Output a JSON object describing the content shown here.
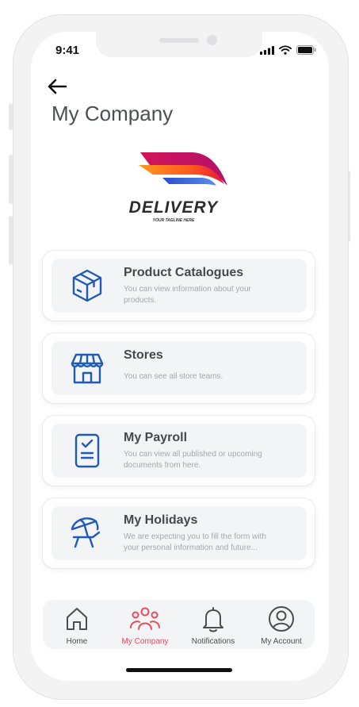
{
  "status": {
    "time": "9:41"
  },
  "page": {
    "title": "My Company"
  },
  "logo": {
    "name": "DELIVERY",
    "tagline": "YOUR TAGLINE HERE"
  },
  "menu": [
    {
      "icon": "box-icon",
      "title": "Product Catalogues",
      "description": "You can view information about your products."
    },
    {
      "icon": "store-icon",
      "title": "Stores",
      "description": "You can see all store teams."
    },
    {
      "icon": "clipboard-check-icon",
      "title": "My Payroll",
      "description": "You can view all published or upcoming documents from here."
    },
    {
      "icon": "beach-umbrella-icon",
      "title": "My Holidays",
      "description": "We are expecting you to fill the form with your personal information and future..."
    }
  ],
  "tabs": [
    {
      "icon": "home-icon",
      "label": "Home",
      "active": false
    },
    {
      "icon": "team-icon",
      "label": "My Company",
      "active": true
    },
    {
      "icon": "bell-icon",
      "label": "Notifications",
      "active": false
    },
    {
      "icon": "user-circle-icon",
      "label": "My Account",
      "active": false
    }
  ],
  "colors": {
    "accent": "#EC4A5C",
    "icon_blue": "#1E5BB8",
    "card_bg": "#F3F4F6",
    "title_text": "#4B5055"
  }
}
